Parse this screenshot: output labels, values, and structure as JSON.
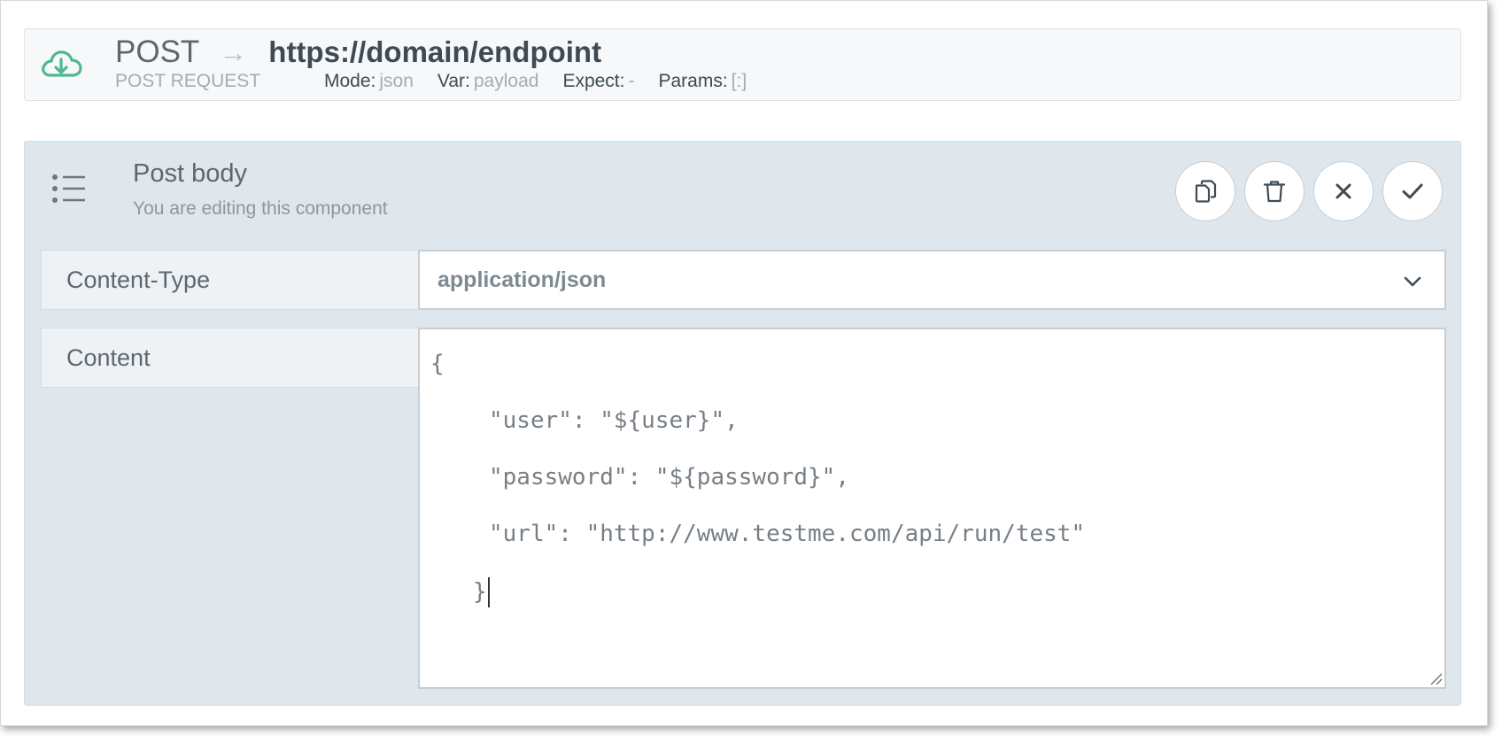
{
  "header": {
    "method": "POST",
    "arrow": "→",
    "url": "https://domain/endpoint",
    "request_type": "POST REQUEST",
    "meta": [
      {
        "label": "Mode:",
        "value": "json"
      },
      {
        "label": "Var:",
        "value": "payload"
      },
      {
        "label": "Expect:",
        "value": "-"
      },
      {
        "label": "Params:",
        "value": "[:]"
      }
    ],
    "icon": "cloud-download-icon",
    "icon_color": "#4db892"
  },
  "panel": {
    "icon": "list-icon",
    "title": "Post body",
    "subtitle": "You are editing this component",
    "actions": [
      {
        "name": "copy-button",
        "icon": "copy-icon"
      },
      {
        "name": "delete-button",
        "icon": "trash-icon"
      },
      {
        "name": "cancel-button",
        "icon": "close-icon"
      },
      {
        "name": "confirm-button",
        "icon": "check-icon"
      }
    ]
  },
  "form": {
    "content_type": {
      "label": "Content-Type",
      "value": "application/json"
    },
    "content": {
      "label": "Content",
      "lines": [
        "{",
        "\"user\": \"${user}\",",
        "\"password\": \"${password}\",",
        "\"url\": \"http://www.testme.com/api/run/test\"",
        "}"
      ]
    }
  },
  "colors": {
    "panel_bg": "#dfe6ec",
    "header_bg": "#f6f8f9",
    "accent_green": "#4db892",
    "button_icon": "#3d4c56"
  }
}
